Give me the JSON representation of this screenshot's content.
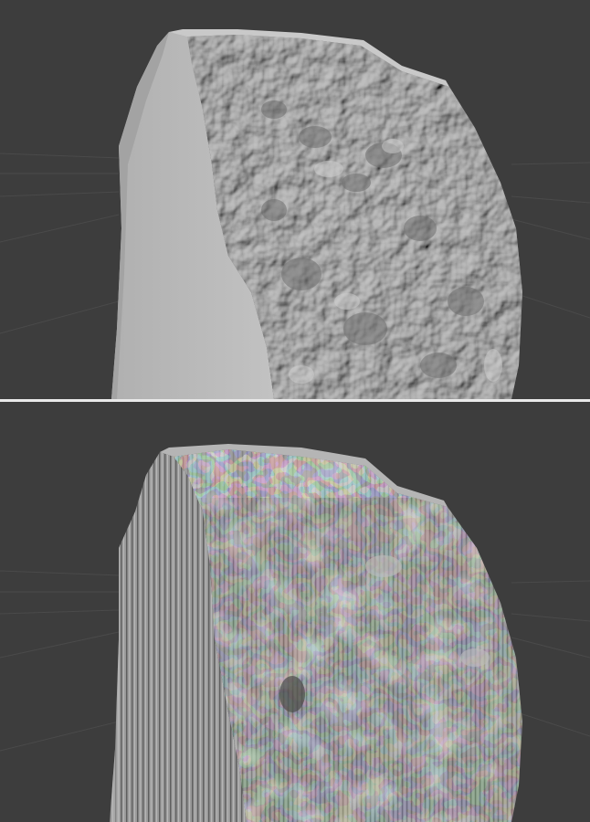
{
  "colors": {
    "viewport_background": "#3d3d3d",
    "grid_line": "#4a4a4a",
    "divider": "#e9e9e9",
    "mesh_smooth_light": "#b9b9b9",
    "mesh_smooth_shadow": "#7c7c7c",
    "mesh_layered_light": "#a5a5a5",
    "mesh_layered_shadow": "#5a5a5a"
  },
  "panels": [
    {
      "name": "viewport-top",
      "shading": "smooth",
      "object": "rock-mesh-smooth"
    },
    {
      "name": "viewport-bottom",
      "shading": "layered",
      "object": "rock-mesh-layered"
    }
  ]
}
